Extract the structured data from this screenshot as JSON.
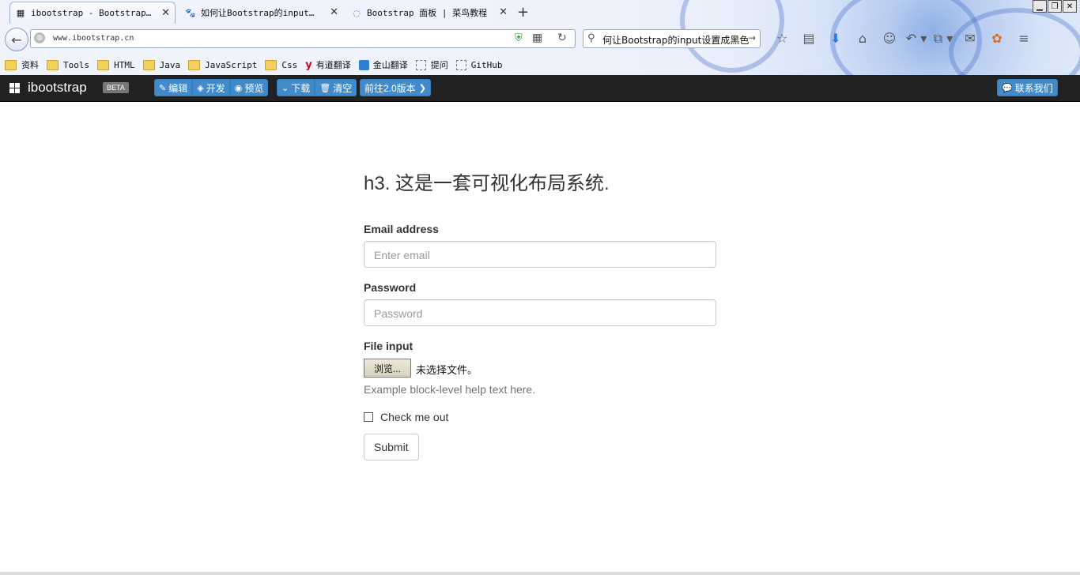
{
  "browser": {
    "tabs": [
      {
        "label": "ibootstrap - Bootstrap…",
        "icon": "grid-favicon",
        "active": true
      },
      {
        "label": "如何让Bootstrap的input…",
        "icon": "baidu-paw-icon",
        "active": false
      },
      {
        "label": "Bootstrap 面板 | 菜鸟教程",
        "icon": "loading-spinner-icon",
        "active": false
      }
    ],
    "new_tab": "+",
    "url": "www.ibootstrap.cn",
    "search_text": "何让Bootstrap的input设置成黑色",
    "toolbar_icons": [
      "star-icon",
      "reading-list-icon",
      "download-icon",
      "home-icon",
      "chat-icon",
      "undo-icon",
      "crop-icon",
      "comment-icon",
      "fox-icon",
      "menu-icon"
    ],
    "bookmarks": [
      {
        "label": "资料",
        "type": "folder"
      },
      {
        "label": "Tools",
        "type": "folder"
      },
      {
        "label": "HTML",
        "type": "folder"
      },
      {
        "label": "Java",
        "type": "folder"
      },
      {
        "label": "JavaScript",
        "type": "folder"
      },
      {
        "label": "Css",
        "type": "folder"
      },
      {
        "label": "有道翻译",
        "type": "youdao"
      },
      {
        "label": "金山翻译",
        "type": "jinshan"
      },
      {
        "label": "提问",
        "type": "page"
      },
      {
        "label": "GitHub",
        "type": "page"
      }
    ]
  },
  "app": {
    "brand": "ibootstrap",
    "beta": "BETA",
    "edit": "编辑",
    "develop": "开发",
    "preview": "预览",
    "download": "下载",
    "clear": "清空",
    "goto_v2": "前往2.0版本",
    "contact": "联系我们"
  },
  "form": {
    "heading": "h3. 这是一套可视化布局系统.",
    "email_label": "Email address",
    "email_placeholder": "Enter email",
    "password_label": "Password",
    "password_placeholder": "Password",
    "file_label": "File input",
    "browse_button": "浏览...",
    "no_file": "未选择文件。",
    "help_text": "Example block-level help text here.",
    "checkbox_label": "Check me out",
    "submit": "Submit"
  }
}
